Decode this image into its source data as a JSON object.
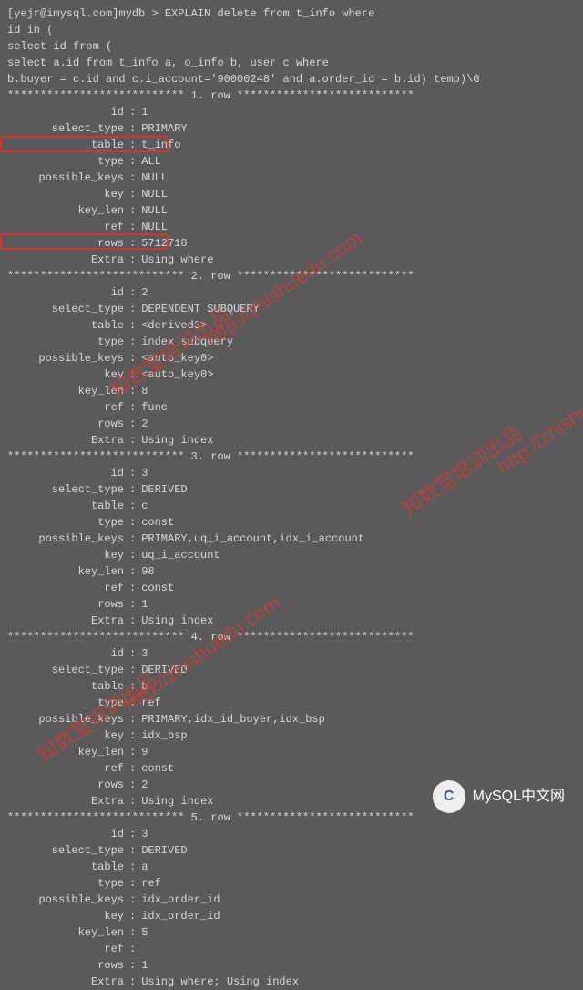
{
  "query": {
    "l1": "[yejr@imysql.com]mydb > EXPLAIN delete from t_info where",
    "l2": "id in (",
    "l3": "select id from (",
    "l4": "select a.id from t_info a, o_info b, user c where",
    "l5": "b.buyer = c.id and c.i_account='90000248' and a.order_id = b.id) temp)\\G"
  },
  "sep": {
    "r1": "*************************** 1. row ***************************",
    "r2": "*************************** 2. row ***************************",
    "r3": "*************************** 3. row ***************************",
    "r4": "*************************** 4. row ***************************",
    "r5": "*************************** 5. row ***************************"
  },
  "labels": {
    "id": "id",
    "select_type": "select_type",
    "table": "table",
    "type": "type",
    "possible_keys": "possible_keys",
    "key": "key",
    "key_len": "key_len",
    "ref": "ref",
    "rows": "rows",
    "Extra": "Extra"
  },
  "rows": {
    "r1": {
      "id": "1",
      "select_type": "PRIMARY",
      "table": "t_info",
      "type": "ALL",
      "possible_keys": "NULL",
      "key": "NULL",
      "key_len": "NULL",
      "ref": "NULL",
      "rows": "5712718",
      "Extra": "Using where"
    },
    "r2": {
      "id": "2",
      "select_type": "DEPENDENT SUBQUERY",
      "table": "<derived3>",
      "type": "index_subquery",
      "possible_keys": "<auto_key0>",
      "key": "<auto_key0>",
      "key_len": "8",
      "ref": "func",
      "rows": "2",
      "Extra": "Using index"
    },
    "r3": {
      "id": "3",
      "select_type": "DERIVED",
      "table": "c",
      "type": "const",
      "possible_keys": "PRIMARY,uq_i_account,idx_i_account",
      "key": "uq_i_account",
      "key_len": "98",
      "ref": "const",
      "rows": "1",
      "Extra": "Using index"
    },
    "r4": {
      "id": "3",
      "select_type": "DERIVED",
      "table": "b",
      "type": "ref",
      "possible_keys": "PRIMARY,idx_id_buyer,idx_bsp",
      "key": "idx_bsp",
      "key_len": "9",
      "ref": "const",
      "rows": "2",
      "Extra": "Using index"
    },
    "r5": {
      "id": "3",
      "select_type": "DERIVED",
      "table": "a",
      "type": "ref",
      "possible_keys": "idx_order_id",
      "key": "idx_order_id",
      "key_len": "5",
      "ref": "",
      "rows": "1",
      "Extra": "Using where; Using index"
    }
  },
  "watermarks": {
    "cn": "知数堂培训出品",
    "url": "http://zhishuedu.com"
  },
  "footer": {
    "avatar": "C",
    "text": "MySQL中文网"
  }
}
